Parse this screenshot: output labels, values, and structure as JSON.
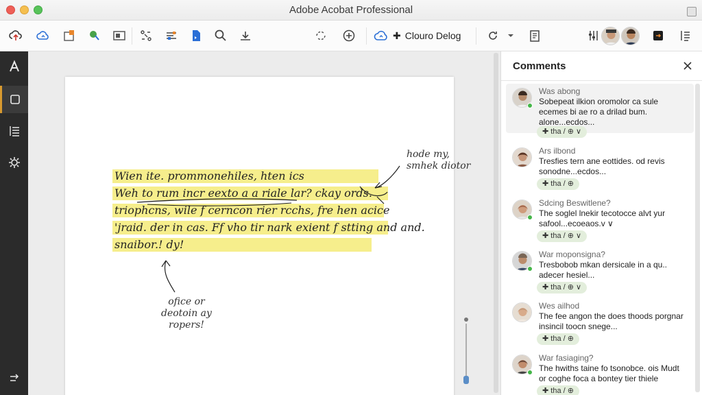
{
  "window": {
    "title": "Adobe Acobat Professional"
  },
  "toolbar": {
    "cloud_label": "Clouro Delog",
    "icons": [
      "upload-cloud-icon",
      "cloud-sync-icon",
      "export-icon",
      "tag-icon",
      "presentation-icon",
      "organize-icon",
      "layout-icon",
      "file-icon",
      "search-icon",
      "text-size-icon",
      "rotate-icon",
      "add-circle-icon",
      "cloud-icon",
      "refresh-icon",
      "chevron-down-icon",
      "notes-icon",
      "settings-sliders-icon",
      "avatar",
      "avatar",
      "present-icon",
      "more-icon"
    ]
  },
  "rail": {
    "items": [
      "text-tool-icon",
      "pages-icon",
      "list-icon",
      "gear-icon",
      "share-back-icon"
    ]
  },
  "document": {
    "highlighted_lines": [
      "Wien ite. prommonehiles, hten ics",
      "Weh to rum incr eexto a a riale lar? ckay ords.",
      "triophcns, wile f cerncon rier rcchs, fre hen acice",
      "'jraid. der in cas. Ff vho tir nark exient f stting and and.",
      "snaibor.! dy!"
    ],
    "note_top": "hode my,\nsmhek diotor",
    "note_bottom": "ofice or\ndeotoin ay\nropers!"
  },
  "comments_panel": {
    "title": "Comments",
    "items": [
      {
        "name": "Was abong",
        "text": "Sobepeat ilkion oromolor ca sule ecemes bi ae ro a drilad bum. alone...ecdos...",
        "chip": "✚ tha / ⊕  ∨",
        "avatar_color": "#b58a6a"
      },
      {
        "name": "Ars ilbond",
        "text": "Tresfies tern ane eottides. od revis sonodne...ecdos...",
        "chip": "✚ tha / ⊕",
        "avatar_color": "#8a5a44"
      },
      {
        "name": "Sdcing Beswitlene?",
        "text": "The soglel lnekir tecotocce alvt yur safool...ecoeaos.v  ∨",
        "chip": "✚ tha / ⊕  ∨",
        "avatar_color": "#a56a4e"
      },
      {
        "name": "War moponsigna?",
        "text": "Tresbobob mkan dersicale in a qu.. adecer hesiel...",
        "chip": "✚ tha / ⊕  ∨",
        "avatar_color": "#7a6656"
      },
      {
        "name": "Wes ailhod",
        "text": "The fee angon the does thoods porgnar insincil toocn snege...",
        "chip": "✚ tha / ⊕",
        "avatar_color": "#c59a7a"
      },
      {
        "name": "War fasiaging?",
        "text": "The hwiths taine fo tsonobce. ois Mudt or coghe foca a bontey tier thiele anecr...",
        "chip": "✚ tha / ⊕",
        "avatar_color": "#6d4a3a"
      }
    ]
  },
  "colors": {
    "highlight": "#f6ee8c",
    "rail": "#2b2b2b",
    "accent": "#d89a2f",
    "chip": "#e3eedc"
  }
}
